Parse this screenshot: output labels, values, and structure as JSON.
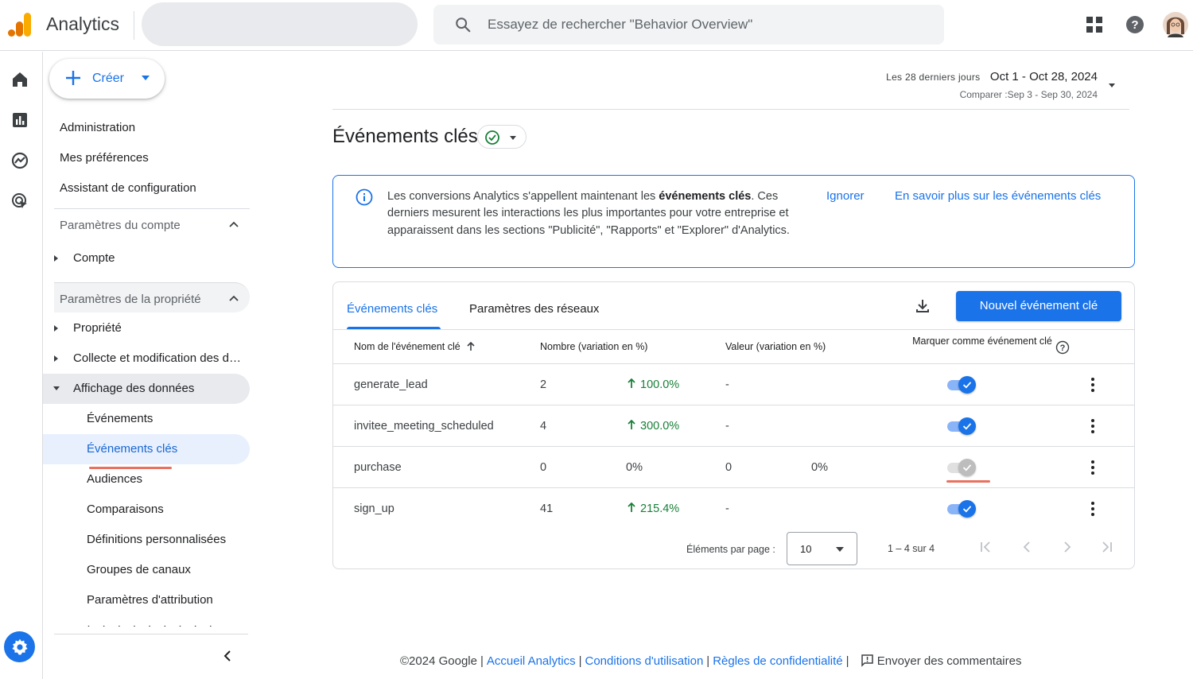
{
  "header": {
    "app_title": "Analytics",
    "search_placeholder": "Essayez de rechercher \"Behavior Overview\""
  },
  "sidenav": {
    "create_label": "Créer",
    "top_items": [
      "Administration",
      "Mes préférences",
      "Assistant de configuration"
    ],
    "account_section": {
      "label": "Paramètres du compte",
      "items": [
        "Compte"
      ]
    },
    "property_section": {
      "label": "Paramètres de la propriété",
      "items": [
        "Propriété",
        "Collecte et modification des données",
        "Affichage des données"
      ]
    },
    "display_sub_items": [
      "Événements",
      "Événements clés",
      "Audiences",
      "Comparaisons",
      "Définitions personnalisées",
      "Groupes de canaux",
      "Paramètres d'attribution"
    ]
  },
  "date_range": {
    "label": "Les 28 derniers jours",
    "value": "Oct 1 - Oct 28, 2024",
    "compare": "Comparer :Sep 3 - Sep 30, 2024"
  },
  "page": {
    "title": "Événements clés"
  },
  "banner": {
    "text_before": "Les conversions Analytics s'appellent maintenant les ",
    "text_bold": "événements clés",
    "text_after": ". Ces derniers mesurent les interactions les plus importantes pour votre entreprise et apparaissent dans les sections \"Publicité\", \"Rapports\" et \"Explorer\" d'Analytics.",
    "dismiss": "Ignorer",
    "learn_more": "En savoir plus sur les événements clés"
  },
  "card": {
    "tabs": [
      "Événements clés",
      "Paramètres des réseaux"
    ],
    "new_button": "Nouvel événement clé",
    "columns": {
      "name": "Nom de l'événement clé",
      "count": "Nombre (variation en %)",
      "value": "Valeur (variation en %)",
      "mark": "Marquer comme événement clé"
    },
    "rows": [
      {
        "name": "generate_lead",
        "count": "2",
        "count_change": "100.0%",
        "count_up": true,
        "value": "-",
        "value_change": "",
        "marked": true
      },
      {
        "name": "invitee_meeting_scheduled",
        "count": "4",
        "count_change": "300.0%",
        "count_up": true,
        "value": "-",
        "value_change": "",
        "marked": true
      },
      {
        "name": "purchase",
        "count": "0",
        "count_change": "0%",
        "count_up": false,
        "value": "0",
        "value_change": "0%",
        "marked": false
      },
      {
        "name": "sign_up",
        "count": "41",
        "count_change": "215.4%",
        "count_up": true,
        "value": "-",
        "value_change": "",
        "marked": true
      }
    ],
    "pager": {
      "label": "Éléments par page :",
      "page_size": "10",
      "range": "1 – 4 sur 4"
    }
  },
  "footer": {
    "copyright": "©2024 Google",
    "links": [
      "Accueil Analytics",
      "Conditions d'utilisation",
      "Règles de confidentialité"
    ],
    "feedback": "Envoyer des commentaires"
  },
  "colors": {
    "accent": "#1a73e8",
    "positive": "#188038",
    "annotation": "#e8715f"
  }
}
